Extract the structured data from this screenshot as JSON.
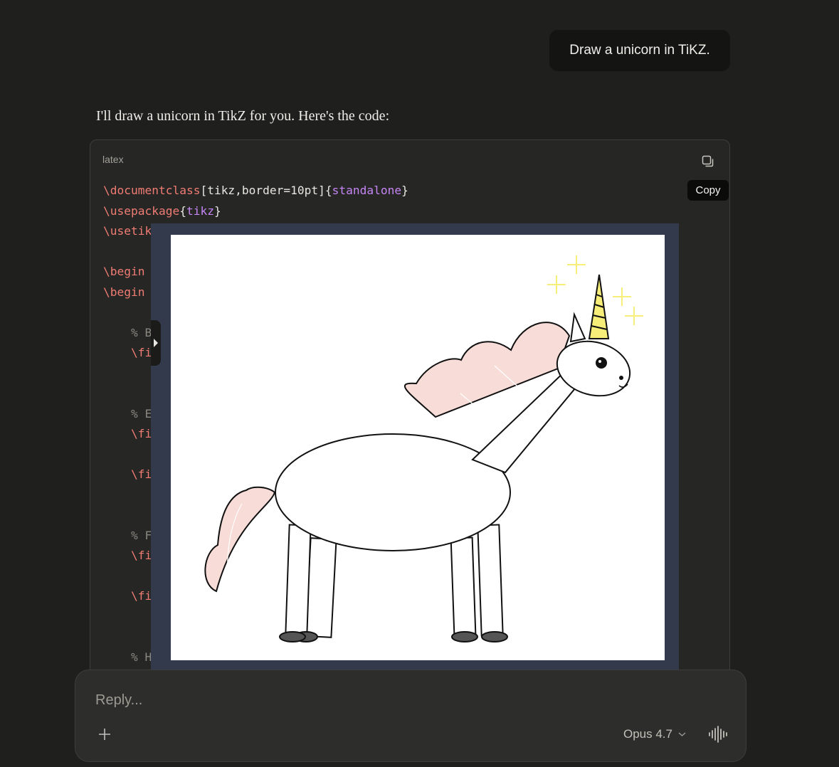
{
  "conversation": {
    "user_message": "Draw a unicorn in TiKZ.",
    "assistant_intro": "I'll draw a unicorn in TikZ for you. Here's the code:"
  },
  "code_block": {
    "language": "latex",
    "copy_tooltip": "Copy",
    "lines": [
      {
        "cmd": "\\documentclass",
        "rest": "[tikz,border=10pt]{",
        "arg": "standalone",
        "tail": "}"
      },
      {
        "cmd": "\\usepackage",
        "rest": "{",
        "arg": "tikz",
        "tail": "}"
      },
      {
        "cmd": "\\usetik"
      },
      {
        "cmd": ""
      },
      {
        "cmd": "\\begin"
      },
      {
        "cmd": "\\begin"
      },
      {
        "cmd": ""
      },
      {
        "indent": "    ",
        "comment": "% B"
      },
      {
        "indent": "    ",
        "cmd": "\\fi"
      },
      {
        "cmd": ""
      },
      {
        "cmd": ""
      },
      {
        "indent": "    ",
        "comment": "% E"
      },
      {
        "indent": "    ",
        "cmd": "\\fi"
      },
      {
        "cmd": ""
      },
      {
        "indent": "    ",
        "cmd": "\\fi"
      },
      {
        "cmd": ""
      },
      {
        "cmd": ""
      },
      {
        "indent": "    ",
        "comment": "% F"
      },
      {
        "indent": "    ",
        "cmd": "\\fi"
      },
      {
        "cmd": ""
      },
      {
        "indent": "    ",
        "cmd": "\\fi"
      },
      {
        "cmd": ""
      },
      {
        "cmd": ""
      },
      {
        "indent": "    ",
        "comment": "% H"
      }
    ]
  },
  "composer": {
    "placeholder": "Reply...",
    "model": "Opus 4.7"
  },
  "icons": {
    "copy": "copy-icon",
    "add": "plus-icon",
    "model_dropdown": "chevron-down-icon",
    "voice": "voice-waveform-icon",
    "panel_handle": "chevron-right-icon"
  },
  "colors": {
    "background": "#1f1f1e",
    "code_command": "#f07c74",
    "code_argument": "#c586f5",
    "preview_frame": "#333a4c",
    "mane": "#f8dcd8",
    "horn": "#f7ee7a",
    "sparkle": "#f6f07a"
  }
}
